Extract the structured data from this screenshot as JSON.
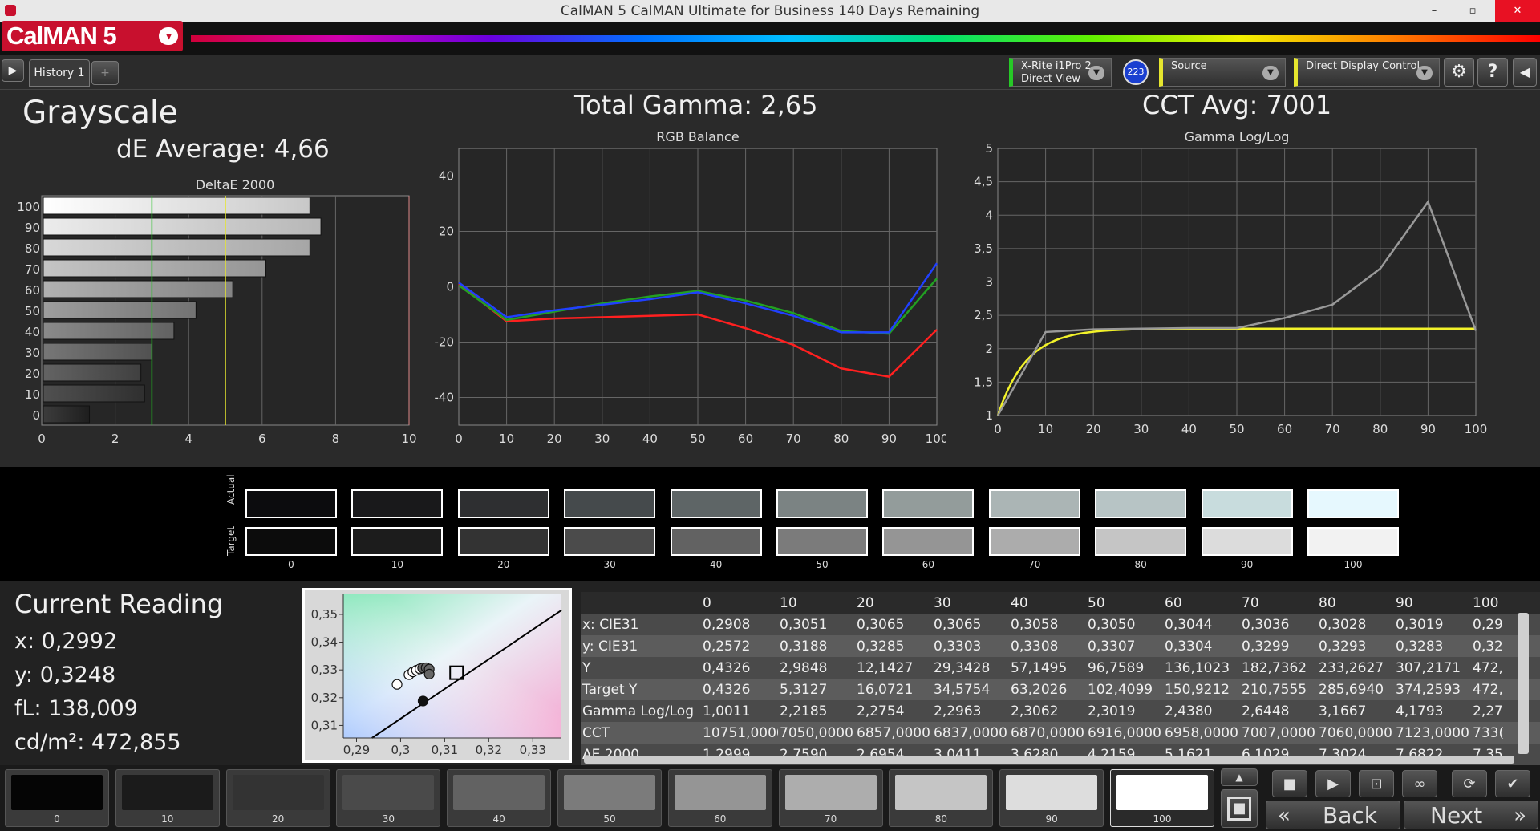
{
  "window": {
    "title": "CalMAN 5 CalMAN Ultimate for Business 140 Days Remaining",
    "minimize": "–",
    "restore": "▫",
    "close": "✕"
  },
  "app": {
    "logo": "CalMAN 5",
    "logo_menu": "▾"
  },
  "tabs": {
    "play": "▶",
    "history_tab": "History 1",
    "add": "+"
  },
  "devices": [
    {
      "line1": "X-Rite i1Pro 2",
      "line2": "Direct View",
      "color": "#26c926"
    },
    {
      "line1": "Source",
      "line2": "",
      "color": "#e6e62e"
    },
    {
      "line1": "Direct Display Control",
      "line2": "",
      "color": "#e6e62e"
    }
  ],
  "device_badge": "223",
  "toolbar": {
    "settings": "⚙",
    "help": "?",
    "collapse": "◀"
  },
  "grayscale": {
    "title": "Grayscale",
    "de_average": "dE Average: 4,66"
  },
  "gamma": {
    "title": "Total Gamma: 2,65"
  },
  "cct": {
    "title": "CCT Avg: 7001"
  },
  "deltae_chart": {
    "title": "DeltaE 2000",
    "levels": [
      "100",
      "90",
      "80",
      "70",
      "60",
      "50",
      "40",
      "30",
      "20",
      "10",
      "0"
    ],
    "values": [
      7.3,
      7.6,
      7.3,
      6.1,
      5.2,
      4.2,
      3.6,
      3.0,
      2.7,
      2.8,
      1.3
    ],
    "xticks": [
      "0",
      "2",
      "4",
      "6",
      "8",
      "10"
    ],
    "green_line": 3,
    "yellow_line": 5,
    "xlim": [
      0,
      10
    ]
  },
  "rgb_chart": {
    "title": "RGB Balance",
    "x": [
      0,
      10,
      20,
      30,
      40,
      50,
      60,
      70,
      80,
      90,
      100
    ],
    "red": [
      1,
      -12.5,
      -11.5,
      -11,
      -10.5,
      -10,
      -15,
      -21,
      -29.5,
      -32.5,
      -15.5
    ],
    "green": [
      0.5,
      -12,
      -9,
      -6,
      -3.5,
      -1.5,
      -5,
      -9.5,
      -16,
      -17,
      3
    ],
    "blue": [
      1.5,
      -11,
      -8.5,
      -6.5,
      -4.5,
      -2,
      -6,
      -10.5,
      -16.5,
      -16.5,
      8.5
    ],
    "xticks": [
      "0",
      "10",
      "20",
      "30",
      "40",
      "50",
      "60",
      "70",
      "80",
      "90",
      "100"
    ],
    "yticks": [
      "40",
      "20",
      "0",
      "-20",
      "-40"
    ],
    "ylim": [
      -50,
      50
    ]
  },
  "gamma_chart": {
    "title": "Gamma Log/Log",
    "x": [
      0,
      10,
      20,
      30,
      40,
      50,
      60,
      70,
      80,
      90,
      100
    ],
    "measured": [
      1.0,
      2.25,
      2.29,
      2.3,
      2.31,
      2.31,
      2.46,
      2.66,
      3.2,
      4.2,
      2.27
    ],
    "target_curve": "gamma-2.3-yellow",
    "xticks": [
      "0",
      "10",
      "20",
      "30",
      "40",
      "50",
      "60",
      "70",
      "80",
      "90",
      "100"
    ],
    "yticks": [
      "5",
      "4,5",
      "4",
      "3,5",
      "3",
      "2,5",
      "2",
      "1,5",
      "1"
    ],
    "ylim": [
      1,
      5
    ]
  },
  "swatches": {
    "actual_label": "Actual",
    "target_label": "Target",
    "labels": [
      "0",
      "10",
      "20",
      "30",
      "40",
      "50",
      "60",
      "70",
      "80",
      "90",
      "100"
    ],
    "actual": [
      "#0c0c0e",
      "#19191b",
      "#2e2f31",
      "#454a4c",
      "#5e6566",
      "#7b8383",
      "#939c9b",
      "#abb5b5",
      "#b7c4c5",
      "#c8dcdd",
      "#e6f8fe"
    ],
    "target": [
      "#0c0c0c",
      "#1c1c1c",
      "#333333",
      "#4b4b4b",
      "#626262",
      "#7b7b7b",
      "#959595",
      "#acacac",
      "#c5c5c5",
      "#dcdcdc",
      "#f2f2f2"
    ]
  },
  "current_reading": {
    "title": "Current Reading",
    "x": "x: 0,2992",
    "y": "y: 0,3248",
    "fl": "fL: 138,009",
    "cdm2": "cd/m²: 472,855"
  },
  "cie_chart": {
    "xticks": [
      "0,29",
      "0,3",
      "0,31",
      "0,32",
      "0,33"
    ],
    "yticks": [
      "0,35",
      "0,34",
      "0,33",
      "0,32",
      "0,31"
    ],
    "xlim": [
      0.287,
      0.3365
    ],
    "ylim": [
      0.3055,
      0.3575
    ],
    "target": {
      "x": 0.3127,
      "y": 0.329
    },
    "points": [
      {
        "x": 0.2992,
        "y": 0.3248
      },
      {
        "x": 0.3019,
        "y": 0.3283
      },
      {
        "x": 0.3028,
        "y": 0.3293
      },
      {
        "x": 0.3036,
        "y": 0.3299
      },
      {
        "x": 0.3044,
        "y": 0.3304
      },
      {
        "x": 0.305,
        "y": 0.3307
      },
      {
        "x": 0.3058,
        "y": 0.3308
      },
      {
        "x": 0.3065,
        "y": 0.3303
      },
      {
        "x": 0.3065,
        "y": 0.3285
      },
      {
        "x": 0.3051,
        "y": 0.3188
      }
    ]
  },
  "table": {
    "headers": [
      "",
      "0",
      "10",
      "20",
      "30",
      "40",
      "50",
      "60",
      "70",
      "80",
      "90",
      "100"
    ],
    "rows": [
      {
        "label": "x: CIE31",
        "values": [
          "0,2908",
          "0,3051",
          "0,3065",
          "0,3065",
          "0,3058",
          "0,3050",
          "0,3044",
          "0,3036",
          "0,3028",
          "0,3019",
          "0,29"
        ]
      },
      {
        "label": "y: CIE31",
        "values": [
          "0,2572",
          "0,3188",
          "0,3285",
          "0,3303",
          "0,3308",
          "0,3307",
          "0,3304",
          "0,3299",
          "0,3293",
          "0,3283",
          "0,32"
        ]
      },
      {
        "label": "Y",
        "values": [
          "0,4326",
          "2,9848",
          "12,1427",
          "29,3428",
          "57,1495",
          "96,7589",
          "136,1023",
          "182,7362",
          "233,2627",
          "307,2171",
          "472,"
        ]
      },
      {
        "label": "Target Y",
        "values": [
          "0,4326",
          "5,3127",
          "16,0721",
          "34,5754",
          "63,2026",
          "102,4099",
          "150,9212",
          "210,7555",
          "285,6940",
          "374,2593",
          "472,"
        ]
      },
      {
        "label": "Gamma Log/Log",
        "values": [
          "1,0011",
          "2,2185",
          "2,2754",
          "2,2963",
          "2,3062",
          "2,3019",
          "2,4380",
          "2,6448",
          "3,1667",
          "4,1793",
          "2,27"
        ]
      },
      {
        "label": "CCT",
        "values": [
          "10751,0000",
          "7050,0000",
          "6857,0000",
          "6837,0000",
          "6870,0000",
          "6916,0000",
          "6958,0000",
          "7007,0000",
          "7060,0000",
          "7123,0000",
          "733("
        ]
      },
      {
        "label": "AE 2000",
        "values": [
          "1,2999",
          "2,7590",
          "2,6954",
          "3,0411",
          "3,6280",
          "4,2159",
          "5,1621",
          "6,1029",
          "7,3024",
          "7,6822",
          "7,35"
        ]
      }
    ]
  },
  "bottom_swatches": {
    "labels": [
      "0",
      "10",
      "20",
      "30",
      "40",
      "50",
      "60",
      "70",
      "80",
      "90",
      "100"
    ],
    "colors": [
      "#050505",
      "#1b1b1b",
      "#333333",
      "#4a4a4a",
      "#626262",
      "#7b7b7b",
      "#959595",
      "#adadad",
      "#c5c5c5",
      "#dddddd",
      "#ffffff"
    ]
  },
  "controls": {
    "up": "▲",
    "stop_all": "■",
    "stop": "■",
    "play": "▶",
    "frame": "⊡",
    "loop": "∞",
    "refresh": "⟳",
    "check": "✔"
  },
  "nav": {
    "back": "Back",
    "next": "Next",
    "back_icon": "«",
    "next_icon": "»"
  }
}
